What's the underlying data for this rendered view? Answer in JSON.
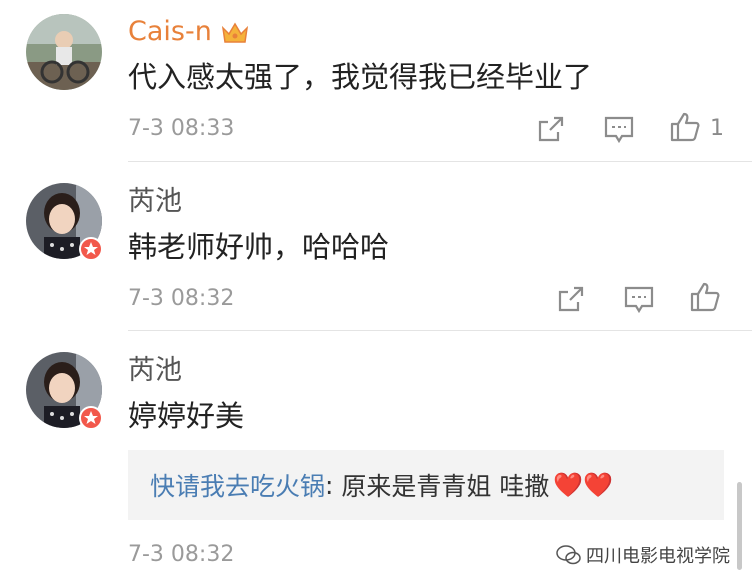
{
  "comments": [
    {
      "username": "Cais-n",
      "text": "代入感太强了，我觉得我已经毕业了",
      "time": "7-3 08:33",
      "like_count": "1"
    },
    {
      "username": "芮池",
      "text": "韩老师好帅，哈哈哈",
      "time": "7-3 08:32"
    },
    {
      "username": "芮池",
      "text": "婷婷好美",
      "time": "7-3 08:32",
      "reply": {
        "username": "快请我去吃火锅",
        "separator": ": ",
        "text": "原来是青青姐 哇撒",
        "hearts": "❤️❤️"
      }
    }
  ],
  "icons": {
    "share": "share-icon",
    "comment": "comment-icon",
    "like": "like-icon",
    "vip": "crown-icon",
    "verified": "verified-badge-icon"
  },
  "colors": {
    "vip_name": "#e8813a",
    "reply_name": "#4a7db3",
    "badge": "#f2584b"
  },
  "watermark": {
    "text": "四川电影电视学院"
  }
}
